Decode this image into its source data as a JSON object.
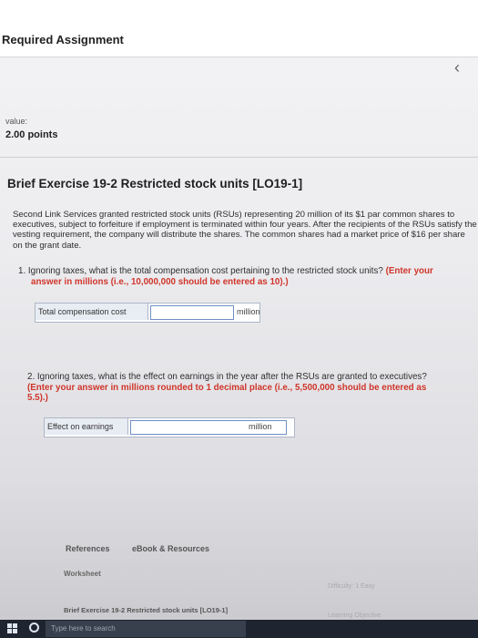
{
  "header": {
    "title": "Required Assignment",
    "back_icon": "chevron-left-icon"
  },
  "score": {
    "label": "value:",
    "points": "2.00 points"
  },
  "exercise": {
    "heading": "Brief Exercise 19-2 Restricted stock units [LO19-1]",
    "description": "Second Link Services granted restricted stock units (RSUs) representing 20 million of its $1 par common shares to executives, subject to forfeiture if employment is terminated within four years. After the recipients of the RSUs satisfy the vesting requirement, the company will distribute the shares. The common shares had a market price of $16 per share on the grant date."
  },
  "question1": {
    "number": "1.",
    "text": "Ignoring taxes, what is the total compensation cost pertaining to the restricted stock units?",
    "instruction_line1": "(Enter your",
    "instruction_line2": "answer in millions (i.e., 10,000,000 should be entered as 10).)",
    "answer_label": "Total compensation cost",
    "answer_value": "",
    "unit": "million"
  },
  "question2": {
    "number": "2.",
    "text": "Ignoring taxes, what is the effect on earnings in the year after the RSUs are granted to executives?",
    "instruction_line1": "(Enter your answer in millions rounded to 1 decimal place (i.e., 5,500,000 should be entered as",
    "instruction_line2": "5.5).)",
    "answer_label": "Effect on earnings",
    "answer_value": "",
    "unit": "million"
  },
  "footer": {
    "references": "References",
    "ebook": "eBook & Resources",
    "worksheet": "Worksheet",
    "brief_exercise_link": "Brief Exercise 19-2 Restricted stock units [LO19-1]",
    "difficulty": "Difficulty: 1 Easy",
    "learning_objective": "Learning Objective"
  },
  "taskbar": {
    "search_placeholder": "Type here to search"
  }
}
